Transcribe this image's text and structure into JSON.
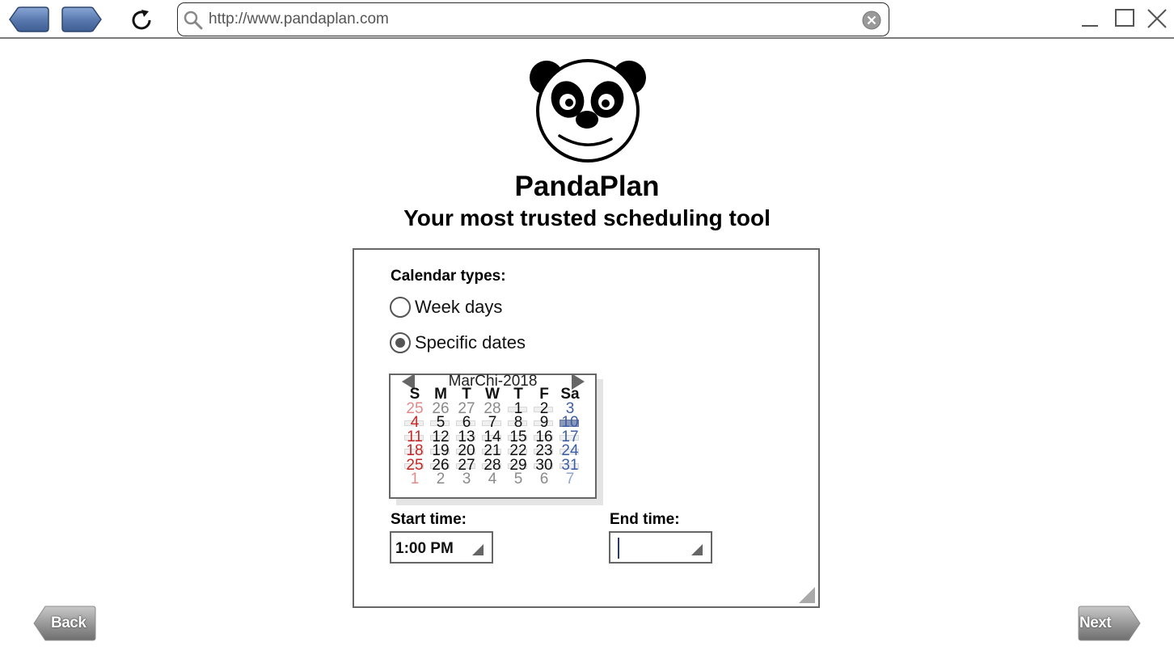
{
  "browser": {
    "url": "http://www.pandaplan.com"
  },
  "header": {
    "title": "PandaPlan",
    "subtitle": "Your most trusted scheduling tool"
  },
  "form": {
    "calendar_types_label": "Calendar types:",
    "options": [
      {
        "label": "Week days",
        "selected": false
      },
      {
        "label": "Specific dates",
        "selected": true
      }
    ],
    "start_time_label": "Start time:",
    "start_time_value": "1:00 PM",
    "end_time_label": "End time:",
    "end_time_value": ""
  },
  "calendar": {
    "month_label": "MarChi-2018",
    "weekday_headers": [
      "S",
      "M",
      "T",
      "W",
      "T",
      "F",
      "Sa"
    ],
    "weeks": [
      [
        "25",
        "26",
        "27",
        "28",
        "1",
        "2",
        "3"
      ],
      [
        "4",
        "5",
        "6",
        "7",
        "8",
        "9",
        "10"
      ],
      [
        "11",
        "12",
        "13",
        "14",
        "15",
        "16",
        "17"
      ],
      [
        "18",
        "19",
        "20",
        "21",
        "22",
        "23",
        "24"
      ],
      [
        "25",
        "26",
        "27",
        "28",
        "29",
        "30",
        "31"
      ],
      [
        "1",
        "2",
        "3",
        "4",
        "5",
        "6",
        "7"
      ]
    ],
    "selected_date": "10"
  },
  "nav": {
    "back_label": "Back",
    "next_label": "Next"
  },
  "colors": {
    "nav_button_blue": "#5b7bb0",
    "sunday_red": "#c62828",
    "saturday_blue": "#3d5fa8",
    "panel_border": "#666666"
  }
}
